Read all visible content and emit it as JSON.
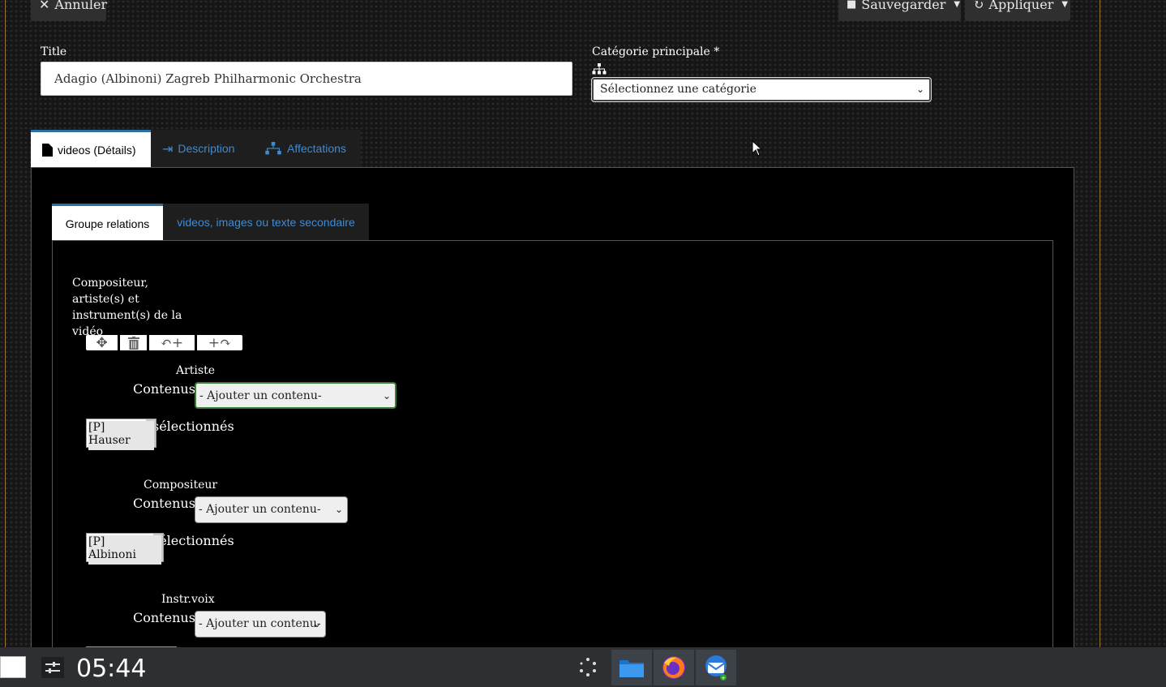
{
  "header": {
    "cancel_label": "Annuler",
    "save_label": "Sauvegarder",
    "apply_label": "Appliquer"
  },
  "form": {
    "title_label": "Title",
    "title_value": "Adagio (Albinoni)  Zagreb Philharmonic Orchestra",
    "category_label": "Catégorie principale *",
    "category_value": "Sélectionnez une catégorie"
  },
  "tabs": [
    {
      "label": "videos (Détails)",
      "active": true
    },
    {
      "label": "Description",
      "active": false
    },
    {
      "label": "Affectations",
      "active": false
    }
  ],
  "subtabs": [
    {
      "label": "Groupe relations",
      "active": true
    },
    {
      "label": "videos, images ou texte secondaire",
      "active": false
    }
  ],
  "group": {
    "description": "Compositeur, artiste(s) et instrument(s) de la vidéo",
    "contenus_label": "Contenus",
    "selected_suffix": "sélectionnés",
    "placeholder": "- Ajouter un contenu-",
    "fields": [
      {
        "label": "Artiste",
        "selected": "[P] Hauser"
      },
      {
        "label": "Compositeur",
        "selected": "[P] Albinoni"
      },
      {
        "label": "Instr.voix",
        "selected": ""
      }
    ]
  },
  "taskbar": {
    "clock": "05:44"
  },
  "colors": {
    "accent": "#2f6f9f",
    "tab_link": "#3d8bd1",
    "frame": "#b98a3a"
  }
}
